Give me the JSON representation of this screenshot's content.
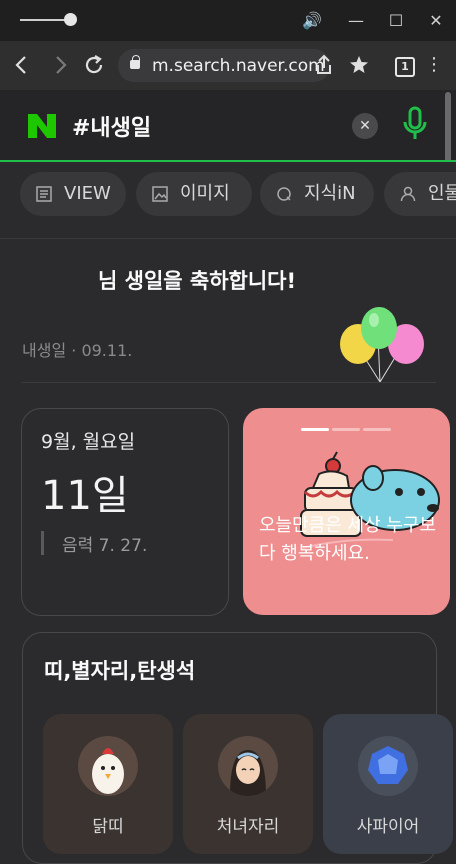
{
  "browser": {
    "url": "m.search.naver.com",
    "tab_count": "1"
  },
  "search": {
    "query": "#내생일"
  },
  "tabs": [
    {
      "label": "VIEW"
    },
    {
      "label": "이미지"
    },
    {
      "label": "지식iN"
    },
    {
      "label": "인물"
    }
  ],
  "birthday": {
    "headline": "님 생일을 축하합니다!",
    "sub_label": "내생일",
    "sub_date": "· 09.11."
  },
  "date_card": {
    "month_weekday": "9월, 월요일",
    "day": "11일",
    "lunar": "음력 7. 27."
  },
  "image_card": {
    "message": "오늘만큼은 세상 누구보다 행복하세요."
  },
  "zodiac": {
    "title": "띠,별자리,탄생석",
    "items": [
      {
        "label": "닭띠"
      },
      {
        "label": "처녀자리"
      },
      {
        "label": "사파이어"
      }
    ]
  }
}
